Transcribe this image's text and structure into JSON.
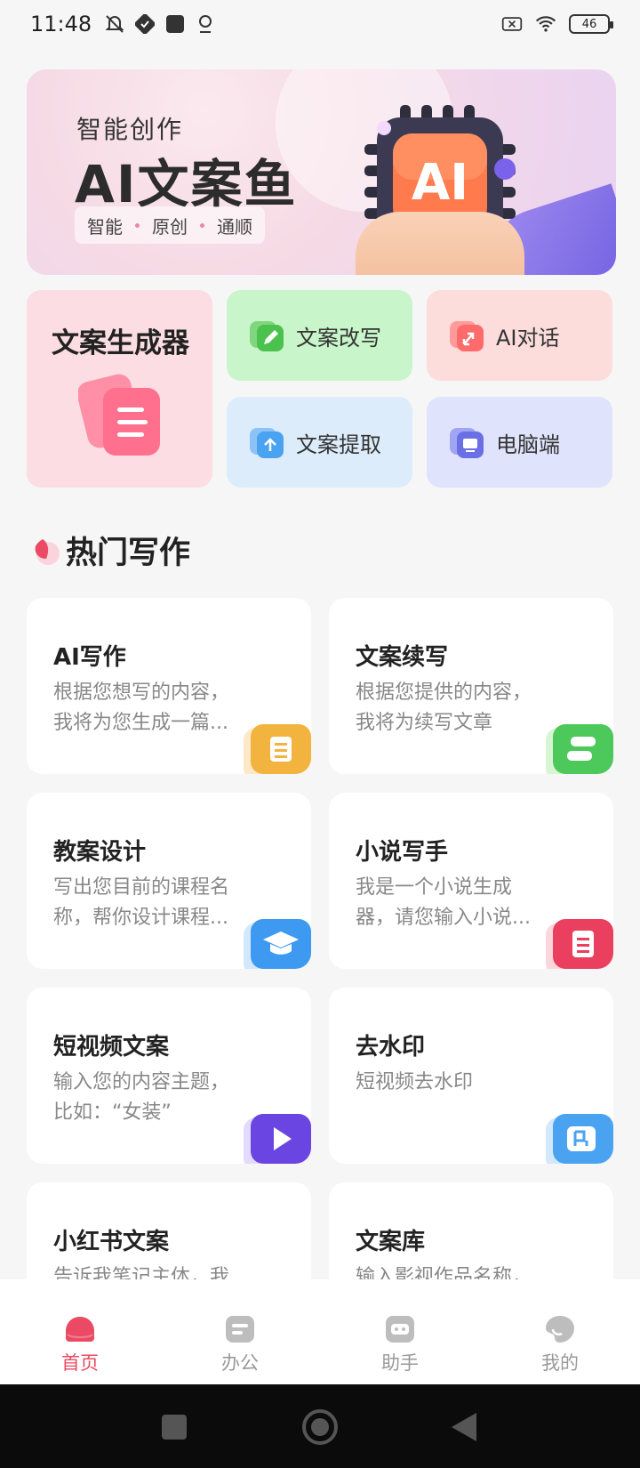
{
  "status_bar": {
    "time": "11:48",
    "battery": "46"
  },
  "banner": {
    "subtitle": "智能创作",
    "title": "AI文案鱼",
    "tags": [
      "智能",
      "原创",
      "通顺"
    ],
    "chip_label": "AI"
  },
  "generator": {
    "title": "文案生成器"
  },
  "tiles": [
    {
      "label": "文案改写"
    },
    {
      "label": "AI对话"
    },
    {
      "label": "文案提取"
    },
    {
      "label": "电脑端"
    }
  ],
  "section": {
    "title": "热门写作"
  },
  "cards": [
    {
      "title": "AI写作",
      "desc": "根据您想写的内容，我将为您生成一篇..."
    },
    {
      "title": "文案续写",
      "desc": "根据您提供的内容，我将为续写文章"
    },
    {
      "title": "教案设计",
      "desc": "写出您目前的课程名称，帮你设计课程..."
    },
    {
      "title": "小说写手",
      "desc": "我是一个小说生成器，请您输入小说..."
    },
    {
      "title": "短视频文案",
      "desc": "输入您的内容主题，比如：“女装”"
    },
    {
      "title": "去水印",
      "desc": "短视频去水印"
    },
    {
      "title": "小红书文案",
      "desc": "告诉我笔记主体，我"
    },
    {
      "title": "文案库",
      "desc": "输入影视作品名称，"
    }
  ],
  "tabbar": [
    {
      "label": "首页",
      "active": true
    },
    {
      "label": "办公",
      "active": false
    },
    {
      "label": "助手",
      "active": false
    },
    {
      "label": "我的",
      "active": false
    }
  ],
  "colors": {
    "accent": "#ea4a63"
  }
}
